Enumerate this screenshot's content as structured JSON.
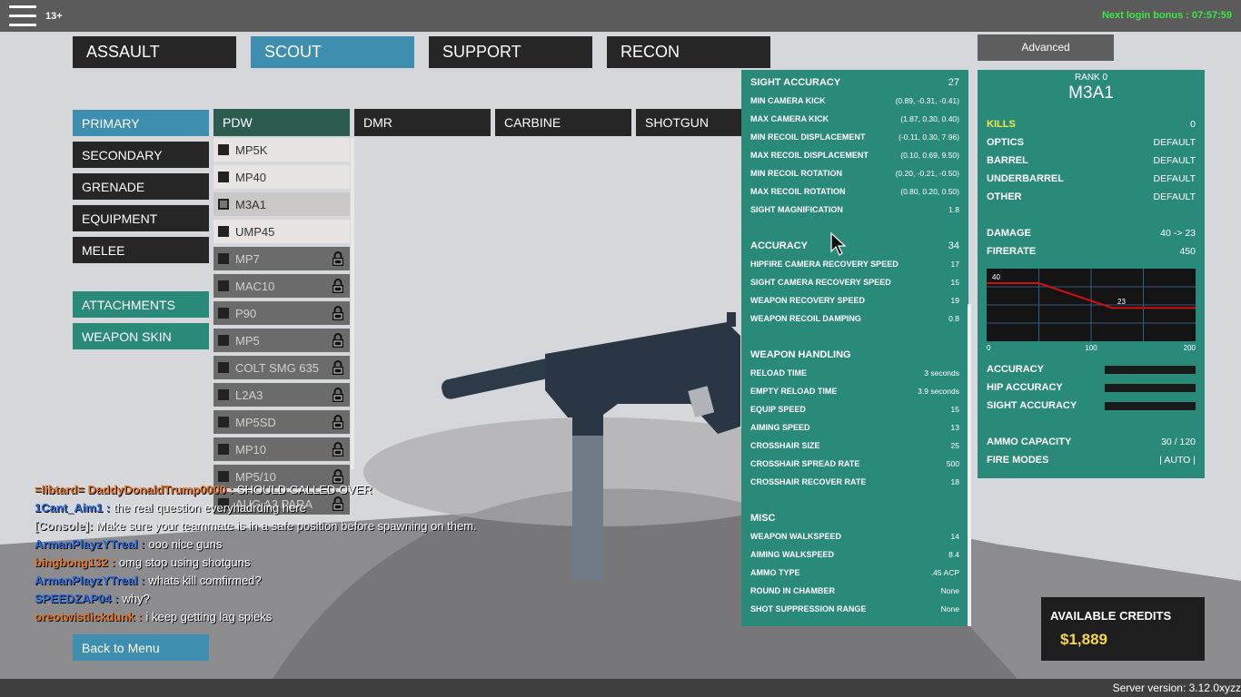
{
  "topbar": {
    "age_rating": "13+",
    "login_bonus": "Next login bonus : 07:57:59"
  },
  "class_tabs": [
    "ASSAULT",
    "SCOUT",
    "SUPPORT",
    "RECON"
  ],
  "advanced_label": "Advanced",
  "left_menu": {
    "slots": [
      "PRIMARY",
      "SECONDARY",
      "GRENADE",
      "EQUIPMENT",
      "MELEE"
    ],
    "attachments": "ATTACHMENTS",
    "weapon_skin": "WEAPON SKIN",
    "back": "Back to Menu"
  },
  "categories": [
    "PDW",
    "DMR",
    "CARBINE",
    "SHOTGUN"
  ],
  "weapons": [
    {
      "name": "MP5K",
      "state": "unlocked"
    },
    {
      "name": "MP40",
      "state": "unlocked"
    },
    {
      "name": "M3A1",
      "state": "selected"
    },
    {
      "name": "UMP45",
      "state": "unlocked"
    },
    {
      "name": "MP7",
      "state": "locked"
    },
    {
      "name": "MAC10",
      "state": "locked"
    },
    {
      "name": "P90",
      "state": "locked"
    },
    {
      "name": "MP5",
      "state": "locked"
    },
    {
      "name": "COLT SMG 635",
      "state": "locked"
    },
    {
      "name": "L2A3",
      "state": "locked"
    },
    {
      "name": "MP5SD",
      "state": "locked"
    },
    {
      "name": "MP10",
      "state": "locked"
    },
    {
      "name": "MP5/10",
      "state": "locked"
    },
    {
      "name": "AUG A3 PARA",
      "state": "locked"
    }
  ],
  "stats": {
    "sight_accuracy": {
      "title": "SIGHT ACCURACY",
      "value": "27",
      "rows": [
        [
          "MIN CAMERA KICK",
          "(0.89, -0.31, -0.41)"
        ],
        [
          "MAX CAMERA KICK",
          "(1.87, 0.30, 0.40)"
        ],
        [
          "MIN RECOIL DISPLACEMENT",
          "(-0.11, 0.30, 7.96)"
        ],
        [
          "MAX RECOIL DISPLACEMENT",
          "(0.10, 0.69, 9.50)"
        ],
        [
          "MIN RECOIL ROTATION",
          "(0.20, -0.21, -0.50)"
        ],
        [
          "MAX RECOIL ROTATION",
          "(0.80, 0.20, 0.50)"
        ],
        [
          "SIGHT MAGNIFICATION",
          "1.8"
        ]
      ]
    },
    "accuracy": {
      "title": "ACCURACY",
      "value": "34",
      "rows": [
        [
          "HIPFIRE CAMERA RECOVERY SPEED",
          "17"
        ],
        [
          "SIGHT CAMERA RECOVERY SPEED",
          "15"
        ],
        [
          "WEAPON RECOVERY SPEED",
          "19"
        ],
        [
          "WEAPON RECOIL DAMPING",
          "0.8"
        ]
      ]
    },
    "handling": {
      "title": "WEAPON HANDLING",
      "rows": [
        [
          "RELOAD TIME",
          "3 seconds"
        ],
        [
          "EMPTY RELOAD TIME",
          "3.9 seconds"
        ],
        [
          "EQUIP SPEED",
          "15"
        ],
        [
          "AIMING SPEED",
          "13"
        ],
        [
          "CROSSHAIR SIZE",
          "25"
        ],
        [
          "CROSSHAIR SPREAD RATE",
          "500"
        ],
        [
          "CROSSHAIR RECOVER RATE",
          "18"
        ]
      ]
    },
    "misc": {
      "title": "MISC",
      "rows": [
        [
          "WEAPON WALKSPEED",
          "14"
        ],
        [
          "AIMING WALKSPEED",
          "8.4"
        ],
        [
          "AMMO TYPE",
          ".45 ACP"
        ],
        [
          "ROUND IN CHAMBER",
          "None"
        ],
        [
          "SHOT SUPPRESSION RANGE",
          "None"
        ]
      ]
    }
  },
  "info": {
    "rank": "RANK 0",
    "weapon_name": "M3A1",
    "kills_label": "KILLS",
    "kills_value": "0",
    "slots": [
      [
        "OPTICS",
        "DEFAULT"
      ],
      [
        "BARREL",
        "DEFAULT"
      ],
      [
        "UNDERBARREL",
        "DEFAULT"
      ],
      [
        "OTHER",
        "DEFAULT"
      ]
    ],
    "damage_label": "DAMAGE",
    "damage_value": "40 -> 23",
    "firerate_label": "FIRERATE",
    "firerate_value": "450",
    "bars": [
      {
        "label": "ACCURACY"
      },
      {
        "label": "HIP ACCURACY"
      },
      {
        "label": "SIGHT ACCURACY"
      }
    ],
    "ammo_label": "AMMO CAPACITY",
    "ammo_value": "30 / 120",
    "firemodes_label": "FIRE MODES",
    "firemodes_value": "|  AUTO  |"
  },
  "chart_data": {
    "type": "line",
    "x": [
      0,
      50,
      120,
      200
    ],
    "y": [
      40,
      40,
      23,
      23
    ],
    "xlim": [
      0,
      200
    ],
    "ylim": [
      0,
      50
    ],
    "x_ticks": [
      "0",
      "100",
      "200"
    ],
    "labels": [
      {
        "x": 0,
        "y": 40,
        "text": "40"
      },
      {
        "x": 120,
        "y": 23,
        "text": "23"
      }
    ],
    "line_color": "#cc1111"
  },
  "credits": {
    "title": "AVAILABLE CREDITS",
    "value": "$1,889"
  },
  "chat": [
    {
      "name": "=libtard= DaddyDonaldTrump0000 :",
      "color": "#e0762b",
      "msg": "SHOULD CALLED OVER"
    },
    {
      "name": "1Cant_Aim1 :",
      "color": "#2f6fe0",
      "msg": "the real question  everyhadrding here"
    },
    {
      "name": "[Console]:",
      "color": "#dcdcdc",
      "msg": "Make sure your teammate is in a safe position before spawning on them."
    },
    {
      "name": "ArmanPlayzYTreal :",
      "color": "#2f6fe0",
      "msg": "ooo nice guns"
    },
    {
      "name": "bingbong132 :",
      "color": "#e0762b",
      "msg": "omg stop using shotguns"
    },
    {
      "name": "ArmanPlayzYTreal :",
      "color": "#2f6fe0",
      "msg": "whats kill comfirmed?"
    },
    {
      "name": "SPEEDZAP04 :",
      "color": "#2f6fe0",
      "msg": "why?"
    },
    {
      "name": "oreotwistlickdunk :",
      "color": "#e0762b",
      "msg": "i keep getting lag spieks"
    }
  ],
  "server_version": "Server version: 3.12.0xyzz"
}
